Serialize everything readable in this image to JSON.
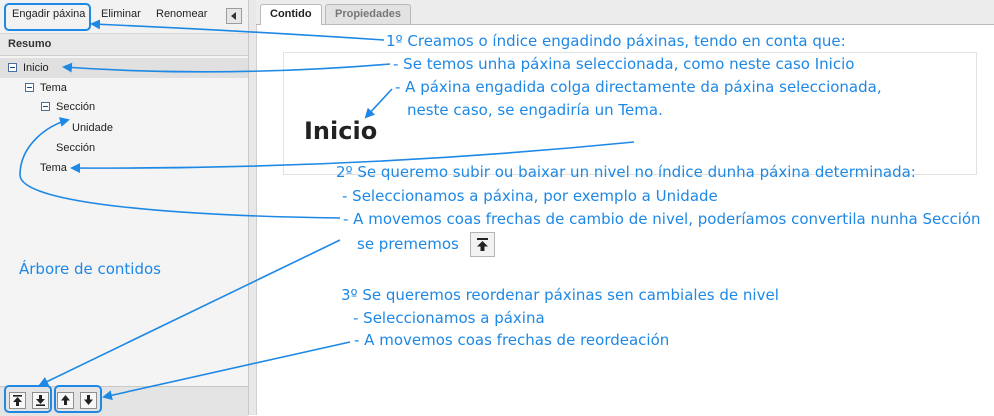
{
  "toolbar": {
    "add_page": "Engadir páxina",
    "delete": "Eliminar",
    "rename": "Renomear"
  },
  "outline": {
    "header": "Resumo",
    "nodes": [
      {
        "label": "Inicio",
        "level": 0,
        "expanded": true,
        "selected": true
      },
      {
        "label": "Tema",
        "level": 1,
        "expanded": true
      },
      {
        "label": "Sección",
        "level": 2,
        "expanded": true
      },
      {
        "label": "Unidade",
        "level": 3
      },
      {
        "label": "Sección",
        "level": 2
      },
      {
        "label": "Tema",
        "level": 1
      }
    ]
  },
  "tabs": [
    {
      "label": "Contido",
      "active": true
    },
    {
      "label": "Propiedades",
      "active": false
    }
  ],
  "content": {
    "page_title": "Inicio"
  },
  "annotations": {
    "tree_label": "Árbore de contidos",
    "block1": [
      "1º Creamos o índice engadindo páxinas, tendo en conta que:",
      "- Se temos unha páxina seleccionada, como neste caso Inicio",
      "- A páxina engadida colga directamente da páxina seleccionada,",
      "neste caso, se engadiría un Tema."
    ],
    "block2": [
      "2º Se queremo subir ou baixar un nivel no índice dunha páxina determinada:",
      "- Seleccionamos a páxina, por exemplo a Unidade",
      "- A movemos coas frechas de cambio de nivel, poderíamos convertila nunha Sección",
      "se prememos"
    ],
    "block3": [
      "3º Se queremos reordenar páxinas sen cambiales de nivel",
      "- Seleccionamos a páxina",
      "- A movemos coas frechas de reordeación"
    ]
  },
  "colors": {
    "annotation": "#1e88e5",
    "selection": "#e0e0e0"
  },
  "icons": [
    "collapse-left-icon",
    "level-up-icon",
    "level-down-icon",
    "move-up-icon",
    "move-down-icon",
    "tree-collapse-icon"
  ]
}
